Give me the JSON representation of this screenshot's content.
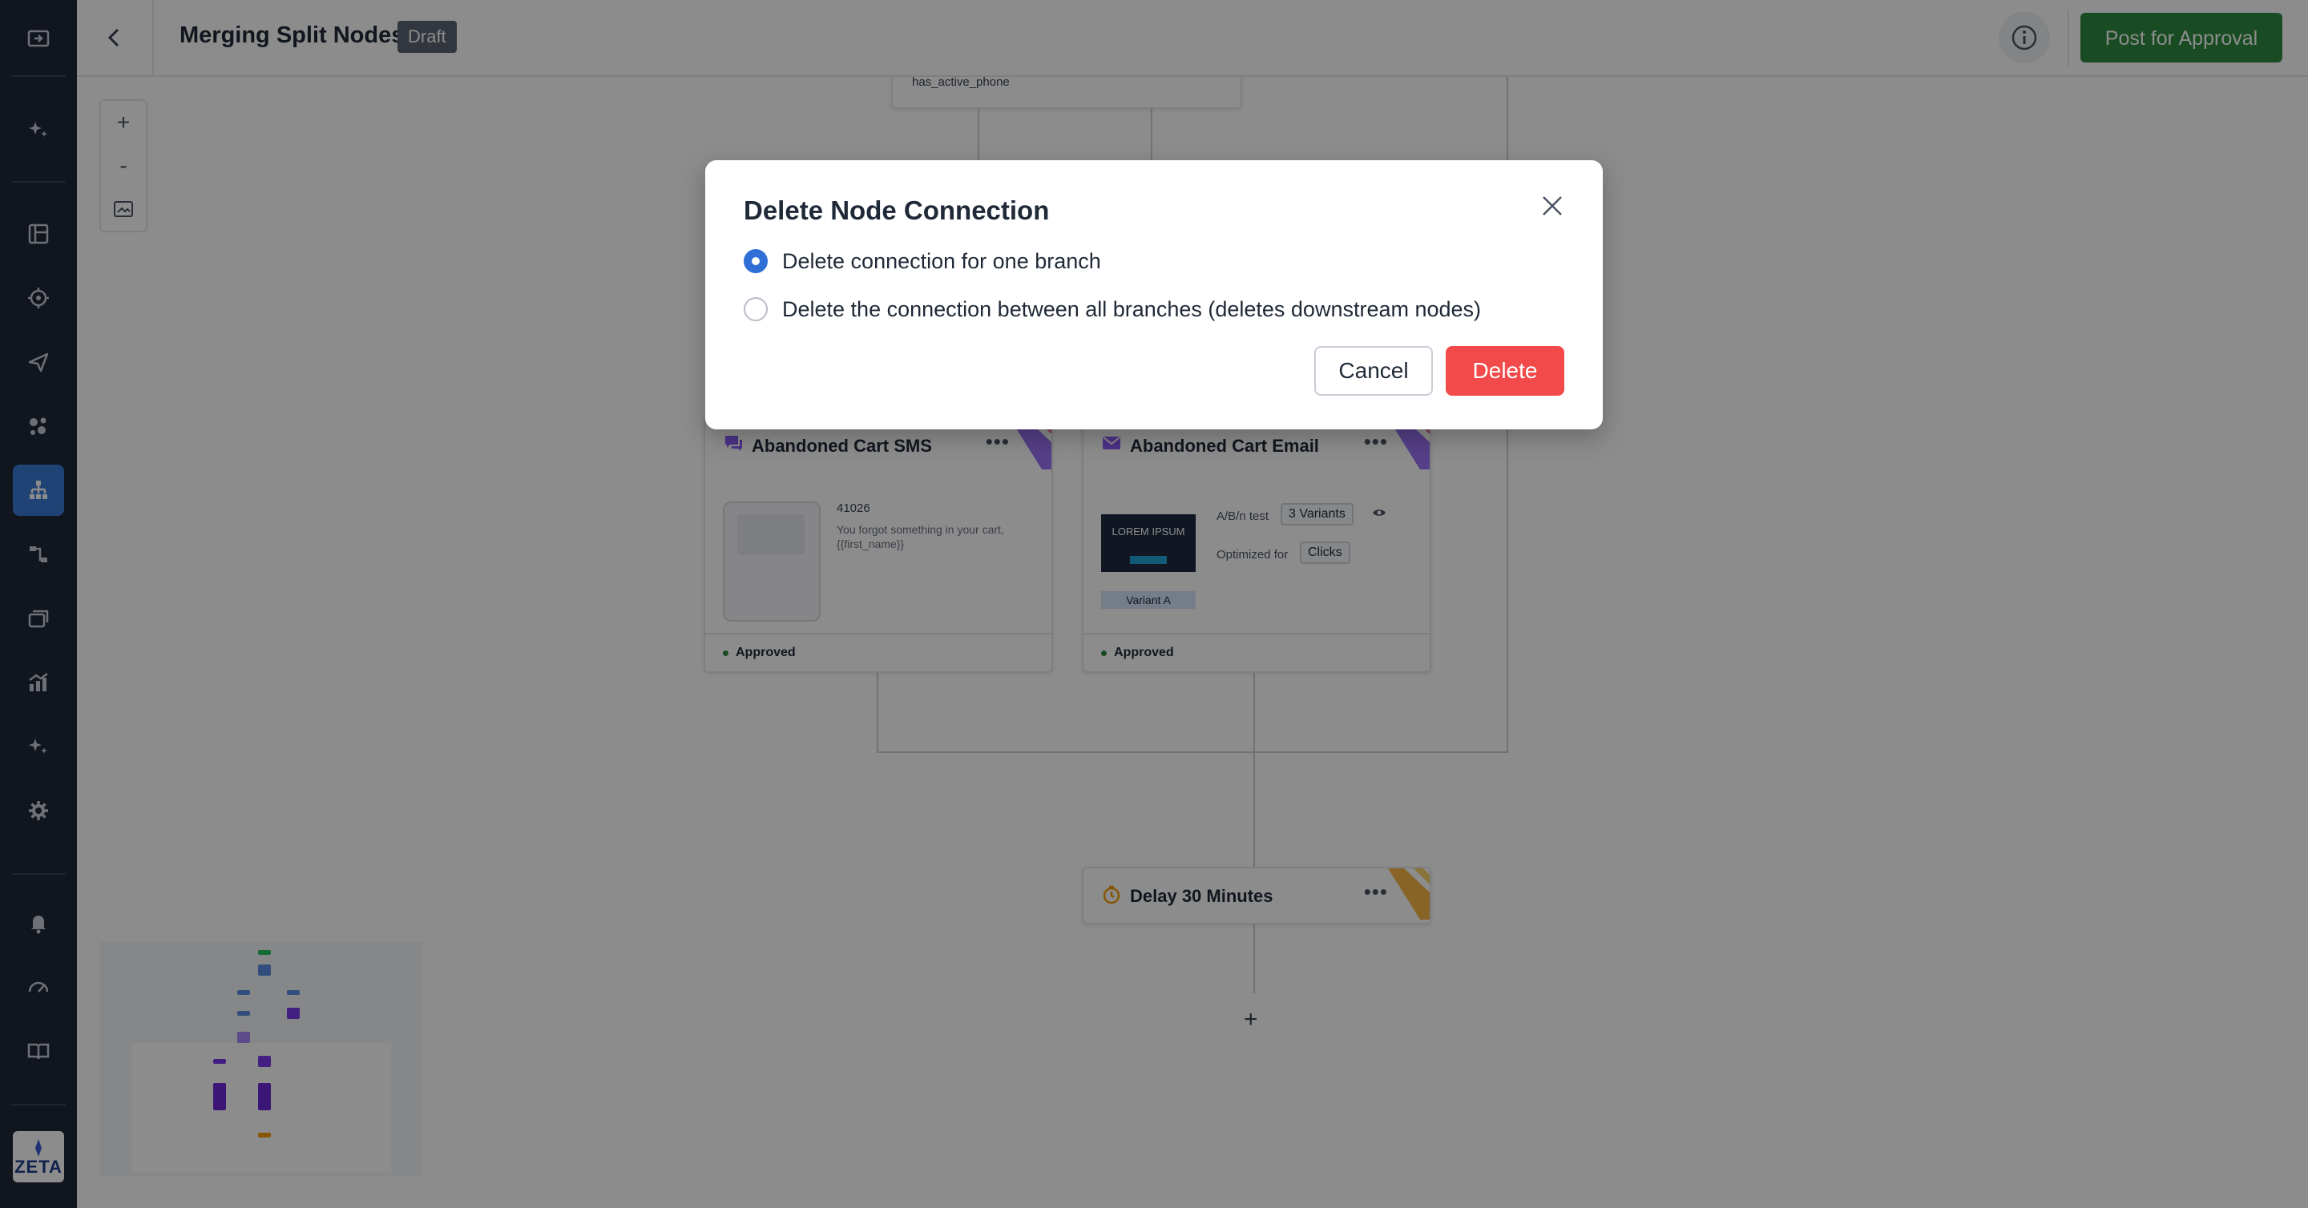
{
  "header": {
    "title": "Merging Split Nodes",
    "status_badge": "Draft",
    "post_button": "Post for Approval"
  },
  "canvas": {
    "top_node_text": "has_active_phone",
    "zoom_in": "+",
    "zoom_out": "-",
    "nodes": [
      {
        "title": "Abandoned Cart SMS",
        "icon": "sms-icon",
        "sms_code": "41026",
        "sms_text": "You forgot something in your cart, {{first_name}}",
        "status": "Approved",
        "accent": "#8b5cf6"
      },
      {
        "title": "Abandoned Cart Email",
        "icon": "email-icon",
        "ab_label": "A/B/n test",
        "variants_chip": "3 Variants",
        "optimized_label": "Optimized for",
        "optimized_chip": "Clicks",
        "preview_heading": "LOREM IPSUM",
        "variant_label": "Variant A",
        "status": "Approved",
        "accent": "#8b5cf6"
      },
      {
        "title": "Delay 30 Minutes",
        "icon": "timer-icon",
        "accent": "#f59e0b"
      }
    ],
    "add_step": "+"
  },
  "modal": {
    "title": "Delete Node Connection",
    "options": [
      {
        "label": "Delete connection for one branch",
        "selected": true
      },
      {
        "label": "Delete the connection between all branches (deletes downstream nodes)",
        "selected": false
      }
    ],
    "cancel": "Cancel",
    "delete": "Delete"
  },
  "brand": {
    "logo_text": "ZETA"
  },
  "colors": {
    "rail": "#1f2838",
    "rail_active": "#3a7bd5",
    "primary": "#2f6fd6",
    "success": "#2e8b3e",
    "danger": "#f24a4a"
  }
}
